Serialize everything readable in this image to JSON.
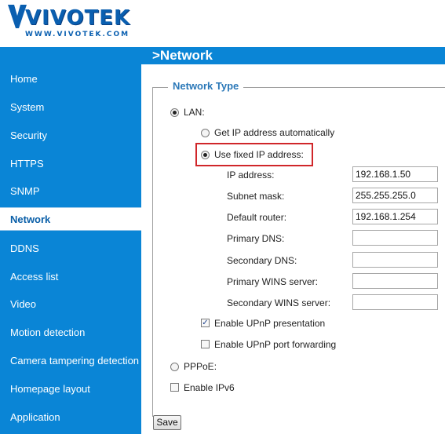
{
  "brand": {
    "logo_text": "VIVOTEK",
    "logo_url": "WWW.VIVOTEK.COM",
    "primary_color": "#0a85d6",
    "accent_color": "#d0262a"
  },
  "page": {
    "title": ">Network"
  },
  "sidebar": {
    "items": [
      {
        "label": "Home"
      },
      {
        "label": "System"
      },
      {
        "label": "Security"
      },
      {
        "label": "HTTPS"
      },
      {
        "label": "SNMP"
      },
      {
        "label": "Network",
        "active": true
      },
      {
        "label": "DDNS"
      },
      {
        "label": "Access list"
      },
      {
        "label": "Video"
      },
      {
        "label": "Motion detection"
      },
      {
        "label": "Camera tampering detection"
      },
      {
        "label": "Homepage layout"
      },
      {
        "label": "Application"
      }
    ]
  },
  "network_type": {
    "legend": "Network Type",
    "lan_label": "LAN:",
    "lan_selected": true,
    "get_ip_auto_label": "Get IP address automatically",
    "use_fixed_ip_label": "Use fixed IP address:",
    "fixed_ip_selected": true,
    "fields": {
      "ip_address": {
        "label": "IP address:",
        "value": "192.168.1.50"
      },
      "subnet_mask": {
        "label": "Subnet mask:",
        "value": "255.255.255.0"
      },
      "default_router": {
        "label": "Default router:",
        "value": "192.168.1.254"
      },
      "primary_dns": {
        "label": "Primary DNS:",
        "value": ""
      },
      "secondary_dns": {
        "label": "Secondary DNS:",
        "value": ""
      },
      "primary_wins": {
        "label": "Primary WINS server:",
        "value": ""
      },
      "secondary_wins": {
        "label": "Secondary WINS server:",
        "value": ""
      }
    },
    "upnp_presentation_label": "Enable UPnP presentation",
    "upnp_presentation_checked": true,
    "upnp_port_forwarding_label": "Enable UPnP port forwarding",
    "upnp_port_forwarding_checked": false,
    "pppoe_label": "PPPoE:",
    "pppoe_selected": false,
    "ipv6_label": "Enable IPv6",
    "ipv6_checked": false
  },
  "actions": {
    "save_label": "Save"
  }
}
